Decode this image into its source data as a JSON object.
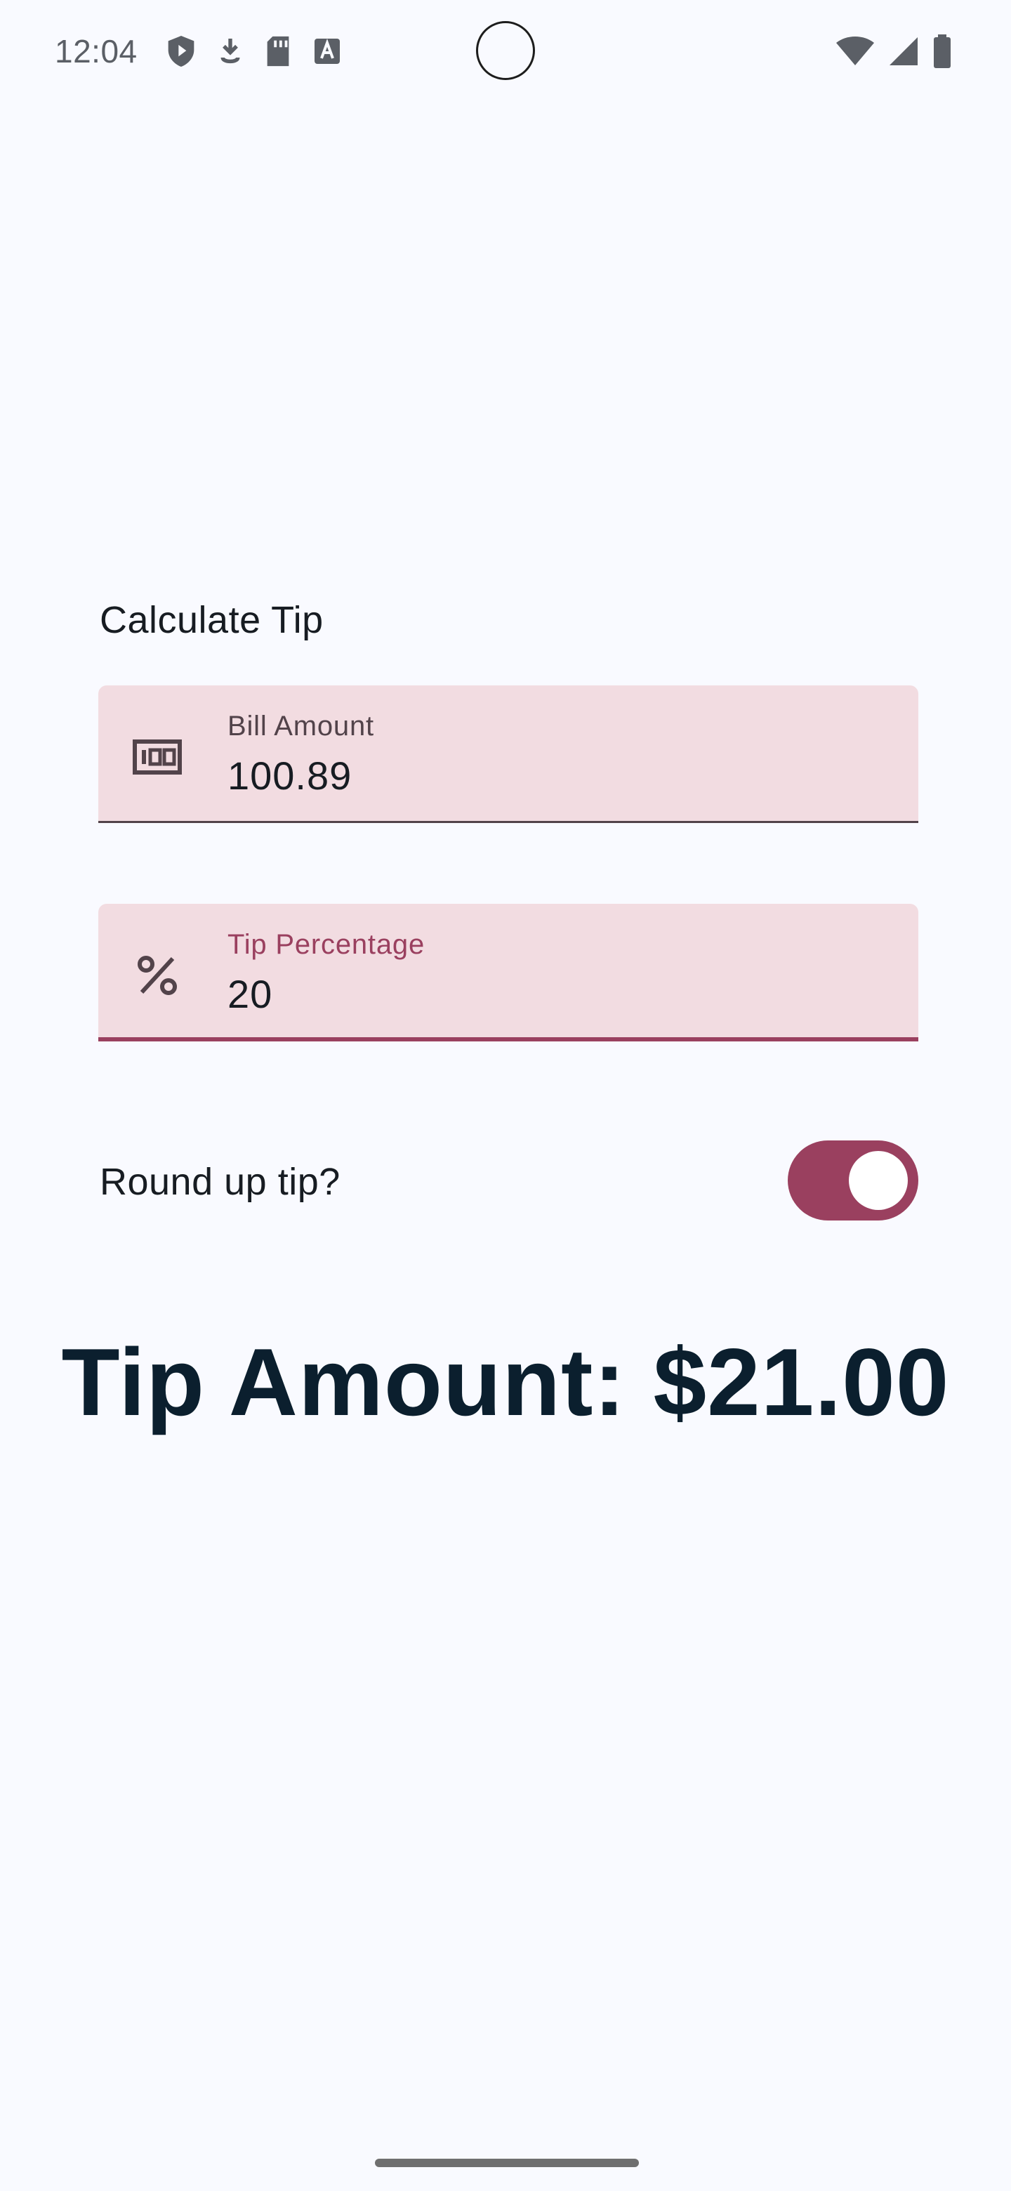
{
  "status_bar": {
    "time": "12:04",
    "left_icons": [
      "shield-icon",
      "download-icon",
      "sd-card-icon",
      "font-a-icon"
    ],
    "right_icons": [
      "wifi-icon",
      "cellular-signal-icon",
      "battery-icon"
    ]
  },
  "main": {
    "title": "Calculate Tip",
    "bill_field": {
      "label": "Bill Amount",
      "value": "100.89",
      "icon": "money-icon"
    },
    "tip_field": {
      "label": "Tip Percentage",
      "value": "20",
      "icon": "percent-icon"
    },
    "round_up": {
      "label": "Round up tip?",
      "checked": true
    },
    "tip_amount": "Tip Amount: $21.00"
  },
  "colors": {
    "background": "#f9faff",
    "field_background": "#f2dce1",
    "accent": "#9a405f",
    "text": "#171c22",
    "tip_amount_text": "#0b1f2e"
  }
}
